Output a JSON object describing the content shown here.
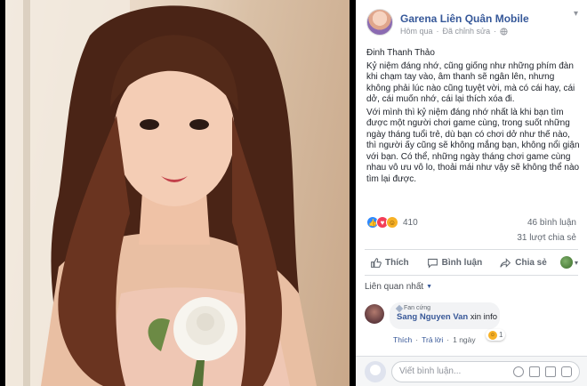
{
  "post": {
    "page_name": "Garena Liên Quân Mobile",
    "timestamp": "Hôm qua",
    "edited": "Đã chỉnh sửa",
    "author_line": "Đinh Thanh Thảo",
    "paragraph1": "Kỷ niệm đáng nhớ, cũng giống như những phím đàn khi chạm tay vào, âm thanh sẽ ngân lên, nhưng không phải lúc nào cũng tuyệt vời, mà có cái hay, cái dở, cái muốn nhớ, cái lại thích xóa đi.",
    "paragraph2": "Với mình thì kỷ niệm đáng nhớ nhất là khi bạn tìm được một người chơi game cùng, trong suốt những ngày tháng tuổi trẻ, dù bạn có chơi dở như thế nào, thì người ấy cũng sẽ không mắng bạn, không nổi giận với bạn. Có thể, những ngày tháng chơi game cùng nhau vô ưu vô lo, thoải mái như vậy sẽ không thể nào tìm lại được."
  },
  "stats": {
    "reaction_count": "410",
    "comments": "46 bình luận",
    "shares": "31 lượt chia sẻ"
  },
  "actions": {
    "like": "Thích",
    "comment": "Bình luận",
    "share": "Chia sẻ"
  },
  "related_label": "Liên quan nhất",
  "comment": {
    "badge": "Fan cứng",
    "author": "Sang Nguyen Van",
    "text": "xin info",
    "like": "Thích",
    "reply": "Trả lời",
    "time": "1 ngày",
    "reaction_count": "1"
  },
  "composer": {
    "placeholder": "Viết bình luận..."
  },
  "colors": {
    "link_blue": "#365899",
    "like_blue": "#2e89ff",
    "love_red": "#f33e58",
    "haha_yellow": "#f7b125"
  }
}
